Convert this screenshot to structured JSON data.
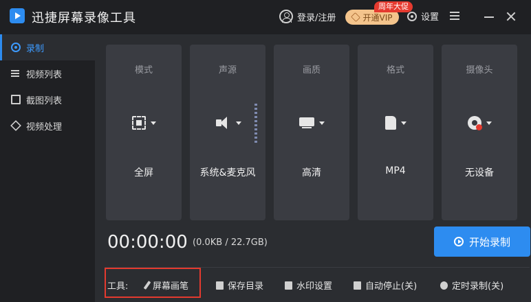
{
  "window": {
    "title": "迅捷屏幕录像工具",
    "login_label": "登录/注册",
    "vip_label": "开通VIP",
    "promo_badge": "周年大促",
    "settings_label": "设置"
  },
  "sidebar": {
    "items": [
      {
        "label": "录制",
        "active": true,
        "icon": "record-icon"
      },
      {
        "label": "视频列表",
        "active": false,
        "icon": "list-icon"
      },
      {
        "label": "截图列表",
        "active": false,
        "icon": "screenshot-icon"
      },
      {
        "label": "视频处理",
        "active": false,
        "icon": "process-icon"
      }
    ]
  },
  "options": [
    {
      "label": "模式",
      "value": "全屏",
      "icon": "fullscreen-icon"
    },
    {
      "label": "声源",
      "value": "系统&麦克风",
      "icon": "speaker-icon"
    },
    {
      "label": "画质",
      "value": "高清",
      "icon": "monitor-icon"
    },
    {
      "label": "格式",
      "value": "MP4",
      "icon": "file-icon"
    },
    {
      "label": "摄像头",
      "value": "无设备",
      "icon": "camera-icon"
    }
  ],
  "status": {
    "timer": "00:00:00",
    "size": "(0.0KB / 22.7GB)"
  },
  "start_button": {
    "label": "开始录制"
  },
  "tools": {
    "label": "工具:",
    "items": [
      {
        "label": "屏幕画笔",
        "icon": "pen-icon"
      },
      {
        "label": "保存目录",
        "icon": "folder-icon"
      },
      {
        "label": "水印设置",
        "icon": "watermark-icon"
      },
      {
        "label": "自动停止(关)",
        "icon": "pause-icon"
      },
      {
        "label": "定时录制(关)",
        "icon": "clock-icon"
      }
    ]
  },
  "colors": {
    "accent": "#2d8cf0",
    "background": "#1f2023",
    "panel": "#2b2d31",
    "card": "#3a3c42",
    "highlight": "#e53a2f",
    "vip": "#f4c48c"
  }
}
